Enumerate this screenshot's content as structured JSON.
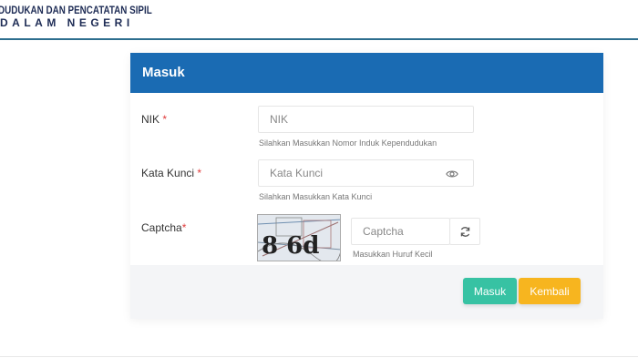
{
  "header": {
    "brand_line1": "DUDUKAN DAN PENCATATAN SIPIL",
    "brand_line2": "DALAM NEGERI"
  },
  "form": {
    "title": "Masuk",
    "nik": {
      "label": "NIK",
      "required_mark": "*",
      "placeholder": "NIK",
      "hint": "Silahkan Masukkan Nomor Induk Kependudukan"
    },
    "password": {
      "label": "Kata Kunci",
      "required_mark": "*",
      "placeholder": "Kata Kunci",
      "hint": "Silahkan Masukkan Kata Kunci",
      "toggle_icon": "eye-icon"
    },
    "captcha": {
      "label": "Captcha",
      "required_mark": "*",
      "image_text": "8 6d",
      "placeholder": "Captcha",
      "hint": "Masukkan Huruf Kecil",
      "refresh_icon": "refresh-icon"
    },
    "buttons": {
      "submit_label": "Masuk",
      "back_label": "Kembali"
    }
  },
  "colors": {
    "header_blue": "#1a6bb3",
    "submit_green": "#37c2a3",
    "back_orange": "#f7b51f",
    "required_red": "#e03b3b"
  }
}
